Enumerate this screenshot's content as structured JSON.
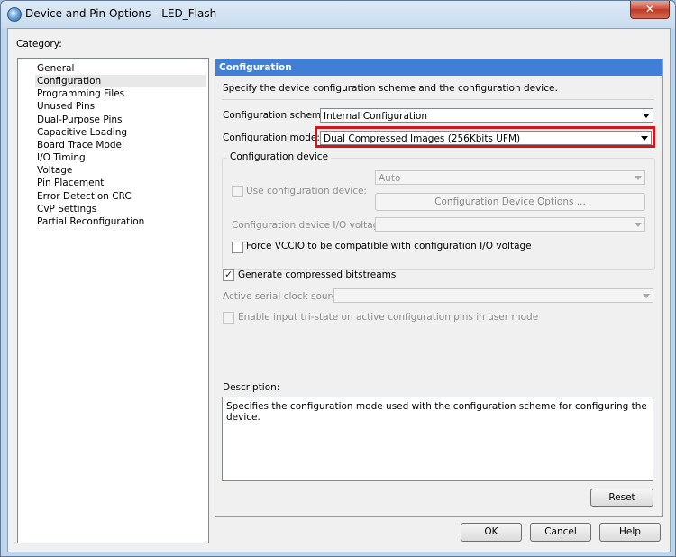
{
  "window": {
    "title": "Device and Pin Options - LED_Flash",
    "close": "✕"
  },
  "category": {
    "label": "Category:",
    "items": [
      "General",
      "Configuration",
      "Programming Files",
      "Unused Pins",
      "Dual-Purpose Pins",
      "Capacitive Loading",
      "Board Trace Model",
      "I/O Timing",
      "Voltage",
      "Pin Placement",
      "Error Detection CRC",
      "CvP Settings",
      "Partial Reconfiguration"
    ],
    "selected": "Configuration"
  },
  "panel": {
    "header": "Configuration",
    "intro": "Specify the device configuration scheme and the configuration device.",
    "scheme_label": "Configuration scheme:",
    "scheme_value": "Internal Configuration",
    "mode_label": "Configuration mode:",
    "mode_value": "Dual Compressed Images (256Kbits UFM)",
    "device_group": {
      "title": "Configuration device",
      "use_device_label": "Use configuration device:",
      "device_value": "Auto",
      "options_button": "Configuration Device Options ...",
      "io_voltage_label": "Configuration device I/O voltage:",
      "io_voltage_value": "",
      "force_vccio_label": "Force VCCIO to be compatible with configuration I/O voltage"
    },
    "generate_compressed_label": "Generate compressed bitstreams",
    "generate_compressed_checked": true,
    "clock_source_label": "Active serial clock source:",
    "clock_source_value": "",
    "tristate_label": "Enable input tri-state on active configuration pins in user mode",
    "description_label": "Description:",
    "description_text": "Specifies the configuration mode used with the configuration scheme for configuring the device.",
    "reset_button": "Reset"
  },
  "footer": {
    "ok": "OK",
    "cancel": "Cancel",
    "help": "Help"
  },
  "colors": {
    "panel_header": "#3f7fd8",
    "highlight": "#d0161b"
  }
}
